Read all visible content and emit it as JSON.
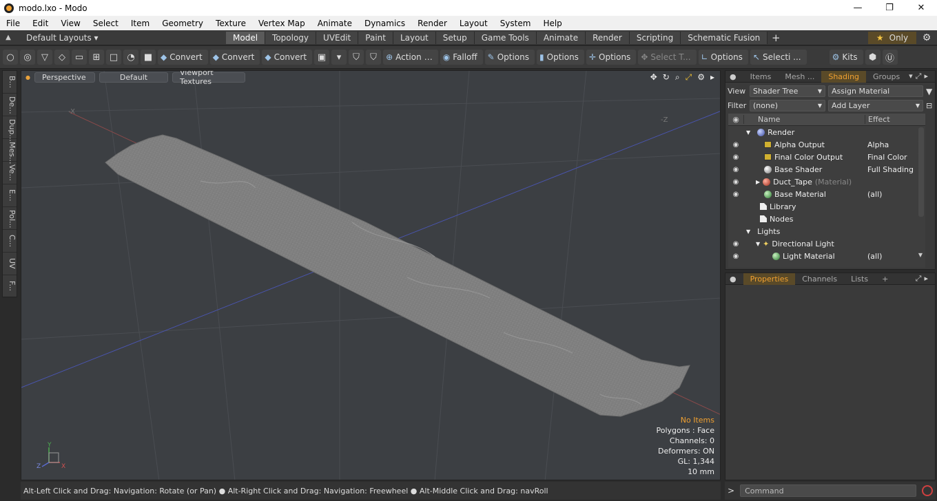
{
  "window": {
    "title": "modo.lxo - Modo",
    "min": "—",
    "max": "❐",
    "close": "✕"
  },
  "menu": [
    "File",
    "Edit",
    "View",
    "Select",
    "Item",
    "Geometry",
    "Texture",
    "Vertex Map",
    "Animate",
    "Dynamics",
    "Render",
    "Layout",
    "System",
    "Help"
  ],
  "layoutbar": {
    "layouts_label": "Default Layouts ▾",
    "tabs": [
      "Model",
      "Topology",
      "UVEdit",
      "Paint",
      "Layout",
      "Setup",
      "Game Tools",
      "Animate",
      "Render",
      "Scripting",
      "Schematic Fusion"
    ],
    "active_tab": "Model",
    "plus": "+",
    "only_label": "Only"
  },
  "toolbar": {
    "convert1": "Convert",
    "convert2": "Convert",
    "convert3": "Convert",
    "action": "Action",
    "falloff": "Falloff",
    "options1": "Options",
    "options2": "Options",
    "options3": "Options",
    "select_t": "Select T...",
    "options4": "Options",
    "selecti": "Selecti ...",
    "kits": "Kits"
  },
  "left_tabs": [
    "B...",
    "De...",
    "Dup...",
    "Mes...",
    "Ve...",
    "E...",
    "Pol...",
    "C...",
    "UV",
    "F..."
  ],
  "viewport": {
    "perspective": "Perspective",
    "default": "Default",
    "textures": "Viewport Textures",
    "info": {
      "no_items": "No Items",
      "polygons": "Polygons : Face",
      "channels": "Channels: 0",
      "deformers": "Deformers: ON",
      "gl": "GL: 1,344",
      "scale": "10 mm"
    },
    "axis_labels": {
      "neg_x": "-X",
      "neg_z": "-Z",
      "y": "Y",
      "z": "Z",
      "x": "X"
    }
  },
  "status_text": "Alt-Left Click and Drag: Navigation: Rotate (or Pan) ● Alt-Right Click and Drag: Navigation: Freewheel ● Alt-Middle Click and Drag: navRoll",
  "shading_panel": {
    "tabs": [
      "Items",
      "Mesh ...",
      "Shading",
      "Groups"
    ],
    "active_tab": "Shading",
    "view_label": "View",
    "view_value": "Shader Tree",
    "assign_material": "Assign Material",
    "filter_label": "Filter",
    "filter_value": "(none)",
    "add_layer": "Add Layer",
    "col_name": "Name",
    "col_effect": "Effect",
    "rows": [
      {
        "name": "Render",
        "effect": ""
      },
      {
        "name": "Alpha Output",
        "effect": "Alpha"
      },
      {
        "name": "Final Color Output",
        "effect": "Final Color"
      },
      {
        "name": "Base Shader",
        "effect": "Full Shading"
      },
      {
        "name": "Duct_Tape",
        "suffix": "(Material)",
        "effect": ""
      },
      {
        "name": "Base Material",
        "effect": "(all)"
      },
      {
        "name": "Library",
        "effect": ""
      },
      {
        "name": "Nodes",
        "effect": ""
      },
      {
        "name": "Lights",
        "effect": ""
      },
      {
        "name": "Directional Light",
        "effect": ""
      },
      {
        "name": "Light Material",
        "effect": "(all)"
      }
    ]
  },
  "props_panel": {
    "tabs": [
      "Properties",
      "Channels",
      "Lists"
    ],
    "active_tab": "Properties",
    "plus": "+"
  },
  "command_placeholder": "Command",
  "colors": {
    "accent": "#f0a030",
    "viewport_bg": "#3c3f43",
    "tape": "#8a8a8a"
  }
}
